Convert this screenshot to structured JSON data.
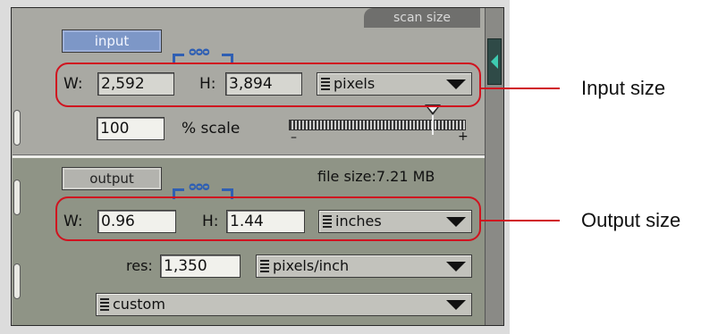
{
  "panel": {
    "tab_label": "scan size",
    "input_button_label": "input",
    "output_button_label": "output",
    "file_size_text": "file size:7.21 MB",
    "link_icon": "chain-link-icon"
  },
  "input": {
    "w_label": "W:",
    "w_value": "2,592",
    "h_label": "H:",
    "h_value": "3,894",
    "units": "pixels",
    "scale_value": "100",
    "scale_label": "% scale",
    "slider_minus": "–",
    "slider_plus": "+"
  },
  "output": {
    "w_label": "W:",
    "w_value": "0.96",
    "h_label": "H:",
    "h_value": "1.44",
    "units": "inches",
    "res_label": "res:",
    "res_value": "1,350",
    "res_units": "pixels/inch",
    "preset": "custom"
  },
  "annotations": {
    "input_callout": "Input size",
    "output_callout": "Output size"
  },
  "colors": {
    "callout": "#d0131f",
    "input_button": "#7d97c7",
    "link": "#2f5fb3",
    "scroll_arrow": "#3ecbb1"
  }
}
